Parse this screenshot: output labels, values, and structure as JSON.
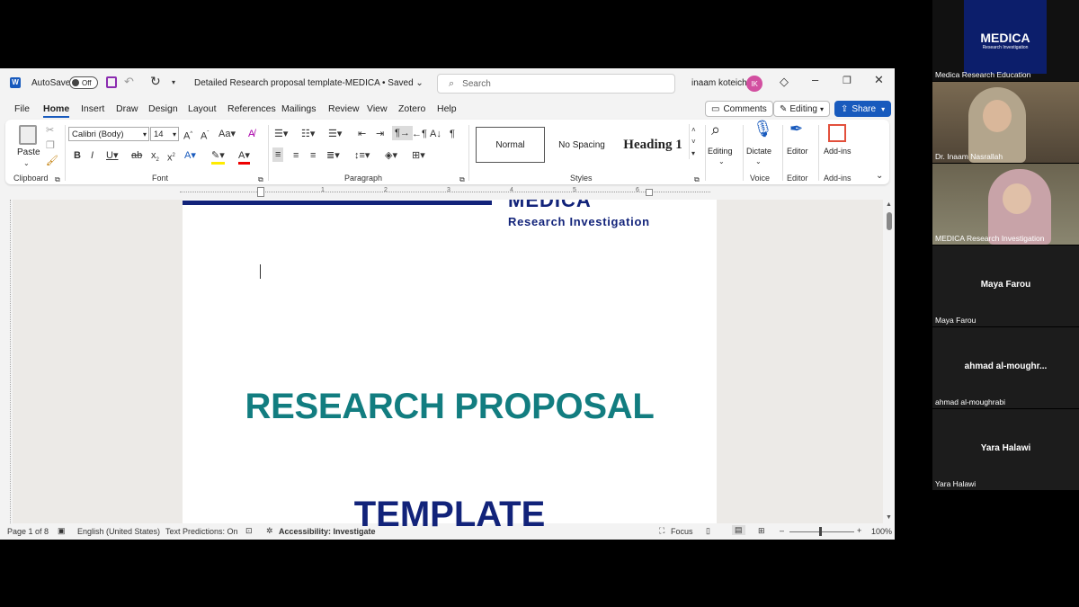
{
  "word": {
    "app_icon": "W",
    "autosave_label": "AutoSave",
    "autosave_state": "Off",
    "doc_title": "Detailed Research proposal template-MEDICA",
    "save_state": "• Saved",
    "search_placeholder": "Search",
    "user_name": "inaam koteich",
    "user_initials": "IK",
    "menu": [
      "File",
      "Home",
      "Insert",
      "Draw",
      "Design",
      "Layout",
      "References",
      "Mailings",
      "Review",
      "View",
      "Zotero",
      "Help"
    ],
    "comments_label": "Comments",
    "editing_label": "Editing",
    "share_label": "Share",
    "ribbon": {
      "paste_label": "Paste",
      "clipboard_label": "Clipboard",
      "font_name": "Calibri (Body)",
      "font_size": "14",
      "font_label": "Font",
      "paragraph_label": "Paragraph",
      "styles": [
        "Normal",
        "No Spacing",
        "Heading 1"
      ],
      "styles_label": "Styles",
      "editing_btn": "Editing",
      "dictate_btn": "Dictate",
      "voice_label": "Voice",
      "editor_btn": "Editor",
      "editor_label": "Editor",
      "addins_btn": "Add-ins",
      "addins_label": "Add-ins"
    },
    "ruler_marks": [
      "1",
      "2",
      "3",
      "4",
      "5",
      "6"
    ],
    "document": {
      "logo_line": "Research Investigation",
      "logo_partial": "MEDICA",
      "heading1": "RESEARCH PROPOSAL",
      "heading2": "TEMPLATE"
    },
    "status": {
      "page": "Page 1 of 8",
      "language": "English (United States)",
      "predictions": "Text Predictions: On",
      "accessibility": "Accessibility: Investigate",
      "focus": "Focus",
      "zoom": "100%"
    }
  },
  "participants": [
    {
      "name": "Medica Research Education",
      "logo_text": "MEDICA",
      "logo_sub": "Research Investigation"
    },
    {
      "name": "Dr. Inaam Nasrallah"
    },
    {
      "name": "MEDICA Research Investigation"
    },
    {
      "display": "Maya Farou",
      "name": "Maya Farou"
    },
    {
      "display": "ahmad al-moughr...",
      "name": "ahmad al-moughrabi"
    },
    {
      "display": "Yara Halawi",
      "name": "Yara Halawi"
    }
  ],
  "colors": {
    "accent": "#185abd",
    "heading1": "#127d80",
    "heading2": "#12237a",
    "avatar": "#d24fa0"
  }
}
